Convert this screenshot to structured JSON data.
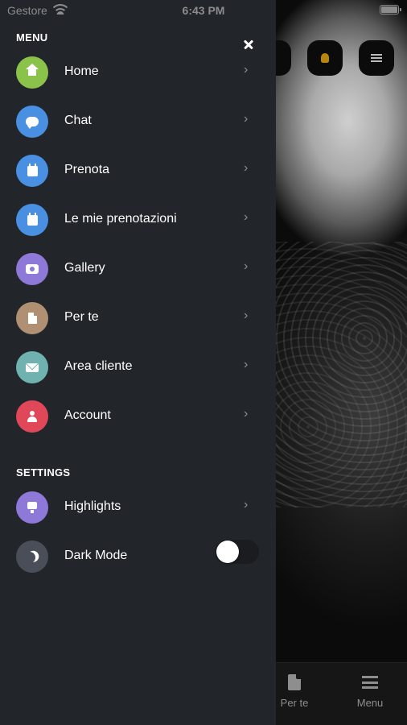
{
  "status_bar": {
    "carrier": "Gestore",
    "time": "6:43 PM"
  },
  "background": {
    "tabs": [
      {
        "label": "Per te",
        "icon": "document-icon"
      },
      {
        "label": "Menu",
        "icon": "menu-icon"
      }
    ]
  },
  "drawer": {
    "menu_title": "MENU",
    "menu_items": [
      {
        "label": "Home",
        "icon": "home-icon",
        "color": "#8bc34a"
      },
      {
        "label": "Chat",
        "icon": "chat-icon",
        "color": "#4a90e2"
      },
      {
        "label": "Prenota",
        "icon": "calendar-icon",
        "color": "#4a90e2"
      },
      {
        "label": "Le mie prenotazioni",
        "icon": "calendar-icon",
        "color": "#4a90e2"
      },
      {
        "label": "Gallery",
        "icon": "camera-icon",
        "color": "#8e79d9"
      },
      {
        "label": "Per te",
        "icon": "document-icon",
        "color": "#b09072"
      },
      {
        "label": "Area cliente",
        "icon": "mail-icon",
        "color": "#6fb2b0"
      },
      {
        "label": "Account",
        "icon": "user-icon",
        "color": "#e0485a"
      }
    ],
    "settings_title": "SETTINGS",
    "settings_items": [
      {
        "label": "Highlights",
        "icon": "highlights-icon",
        "color": "#8e79d9"
      },
      {
        "label": "Dark Mode",
        "icon": "moon-icon",
        "color": "#4a4e58",
        "toggle": false
      }
    ],
    "chevron": "›"
  }
}
